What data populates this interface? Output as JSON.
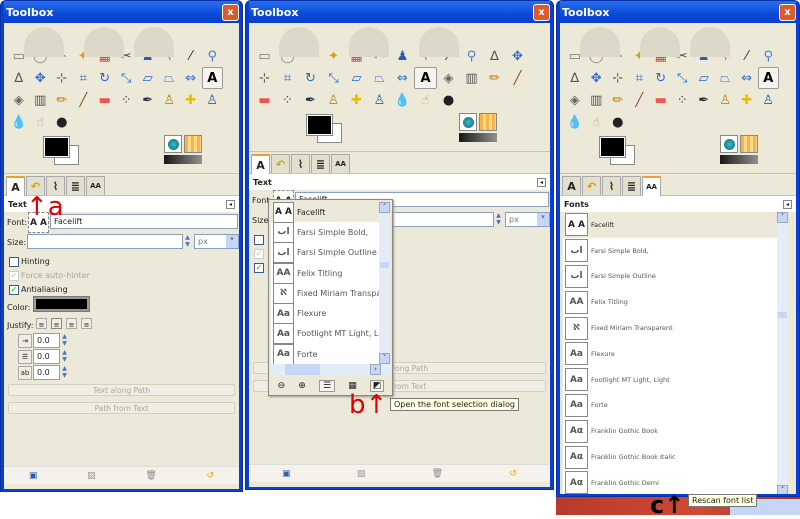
{
  "window_title": "Toolbox",
  "close_glyph": "x",
  "tools": [
    "rect-select",
    "ellipse-select",
    "free-select",
    "fuzzy-select",
    "select-by-color",
    "scissors-select",
    "foreground-select",
    "paths",
    "color-picker",
    "zoom",
    "measure",
    "move",
    "align",
    "crop",
    "rotate",
    "scale",
    "shear",
    "perspective",
    "flip",
    "text",
    "bucket-fill",
    "blend",
    "pencil",
    "paintbrush",
    "eraser",
    "airbrush",
    "ink",
    "clone",
    "heal",
    "perspective-clone",
    "blur-sharpen",
    "smudge",
    "dodge-burn"
  ],
  "active_tool": "text",
  "tabs": [
    "tool-options",
    "undo-history",
    "paths",
    "layers",
    "fonts"
  ],
  "text_panel": {
    "title": "Text",
    "font_label": "Font:",
    "font_value": "Facelift",
    "font_preview": "A A",
    "size_label": "Size:",
    "size_unit": "px",
    "hinting": "Hinting",
    "force_autohinter": "Force auto-hinter",
    "antialiasing": "Antialiasing",
    "color_label": "Color:",
    "justify_label": "Justify:",
    "indent": "0.0",
    "line_spacing": "0.0",
    "letter_spacing": "0.0",
    "text_along_path": "Text along Path",
    "path_from_text": "Path from Text"
  },
  "font_popup": {
    "items": [
      {
        "preview": "A A",
        "name": "Facelift"
      },
      {
        "preview": "اب",
        "name": "Farsi Simple Bold,"
      },
      {
        "preview": "اب",
        "name": "Farsi Simple Outline"
      },
      {
        "preview": "AA",
        "name": "Felix Titling"
      },
      {
        "preview": "ℵ",
        "name": "Fixed Miriam Transparent"
      },
      {
        "preview": "Aa",
        "name": "Flexure"
      },
      {
        "preview": "Aa",
        "name": "Footlight MT Light, Light"
      },
      {
        "preview": "Aa",
        "name": "Forte"
      }
    ],
    "tooltip": "Open the font selection dialog"
  },
  "fonts_panel": {
    "title": "Fonts",
    "items": [
      {
        "preview": "A A",
        "name": "Facelift"
      },
      {
        "preview": "اب",
        "name": "Farsi Simple Bold,"
      },
      {
        "preview": "اب",
        "name": "Farsi Simple Outline"
      },
      {
        "preview": "AA",
        "name": "Felix Titling"
      },
      {
        "preview": "ℵ",
        "name": "Fixed Miriam Transparent"
      },
      {
        "preview": "Aa",
        "name": "Flexure"
      },
      {
        "preview": "Aa",
        "name": "Footlight MT Light, Light"
      },
      {
        "preview": "Aa",
        "name": "Forte"
      },
      {
        "preview": "Aα",
        "name": "Franklin Gothic Book"
      },
      {
        "preview": "Aα",
        "name": "Franklin Gothic Book Italic"
      },
      {
        "preview": "Aα",
        "name": "Franklin Gothic Demi"
      }
    ],
    "tooltip": "Rescan font list"
  },
  "annotations": {
    "a": "a",
    "b": "b",
    "c": "c"
  },
  "colors": {
    "title": "#0a4ad8",
    "body": "#ece9d8",
    "annotation_red": "#e00000"
  }
}
